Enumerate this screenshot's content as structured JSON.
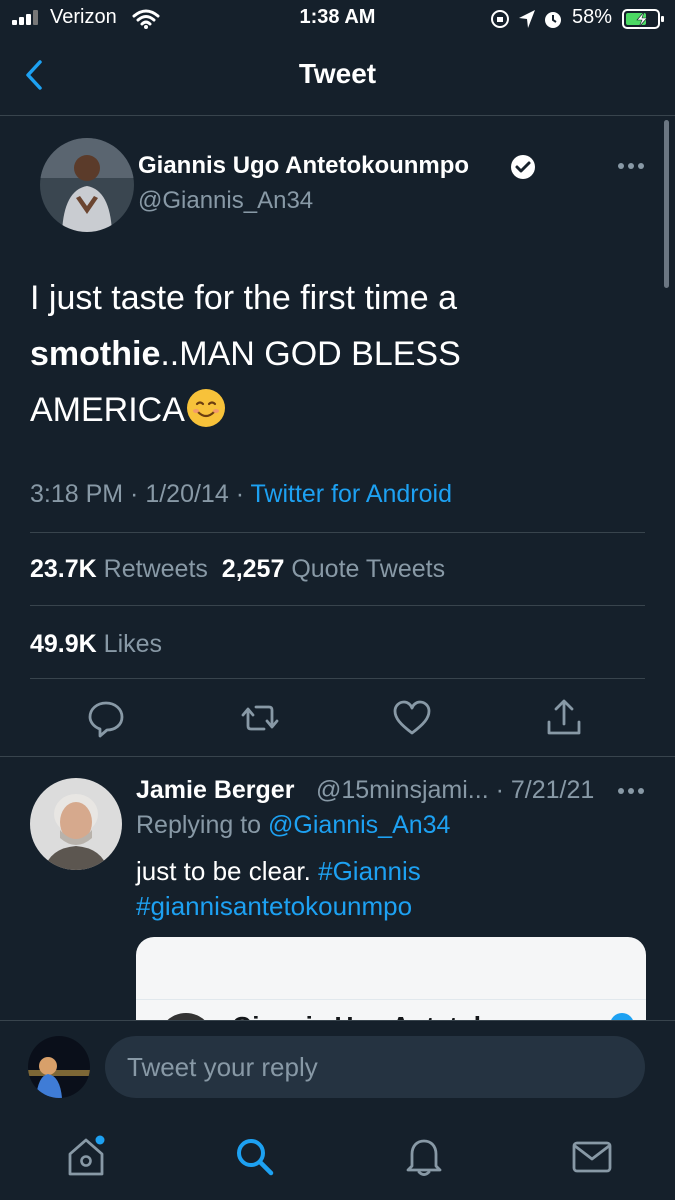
{
  "status_bar": {
    "carrier": "Verizon",
    "time": "1:38 AM",
    "battery": "58%"
  },
  "header": {
    "title": "Tweet",
    "back_icon": "chevron-left-icon"
  },
  "tweet": {
    "author_name": "Giannis Ugo Antetokounmpo",
    "author_handle": "@Giannis_An34",
    "text_line1": "I just taste for the first time a",
    "text_bold": "smothie",
    "text_line2_rest": "..MAN GOD BLESS",
    "text_line3": "AMERICA",
    "time": "3:18 PM",
    "sep1": " · ",
    "date": "1/20/14",
    "sep2": " · ",
    "source": "Twitter for Android",
    "retweets_count": "23.7K",
    "retweets_label": "Retweets",
    "quotes_count": "2,257",
    "quotes_label": "Quote Tweets",
    "likes_count": "49.9K",
    "likes_label": "Likes"
  },
  "reply": {
    "author_name": "Jamie Berger",
    "author_handle": "@15minsjami...",
    "sep": " · ",
    "date": "7/21/21",
    "replying_prefix": "Replying to ",
    "replying_to": "@Giannis_An34",
    "text": "just to be clear. ",
    "tag1": "#Giannis",
    "tag2": "#giannisantetokounmpo",
    "embed_peek_text": "Giannis Ugo Antetok"
  },
  "composer": {
    "placeholder": "Tweet your reply"
  },
  "tab_bar": {
    "items": [
      "home-icon",
      "search-icon",
      "notifications-icon",
      "messages-icon"
    ]
  },
  "colors": {
    "background": "#15202b",
    "accent": "#1da1f2",
    "secondary_text": "#8899a6",
    "divider": "#38444d"
  }
}
